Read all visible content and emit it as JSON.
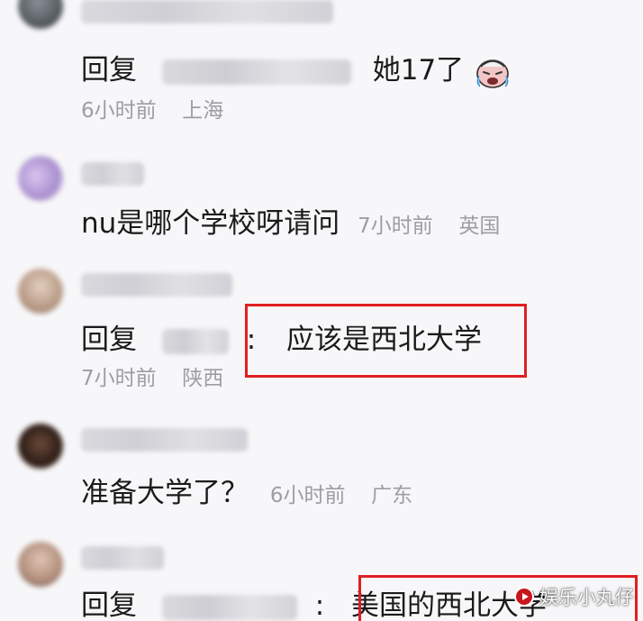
{
  "comments": [
    {
      "reply_prefix": "回复",
      "text": "她17了",
      "time": "6小时前",
      "location": "上海"
    },
    {
      "text": "nu是哪个学校呀请问",
      "time": "7小时前",
      "location": "英国"
    },
    {
      "reply_prefix": "回复",
      "separator": ":",
      "text": "应该是西北大学",
      "time": "7小时前",
      "location": "陕西"
    },
    {
      "text": "准备大学了？",
      "time": "6小时前",
      "location": "广东"
    },
    {
      "reply_prefix": "回复",
      "separator": ":",
      "text": "美国的西北大学"
    }
  ],
  "watermark": {
    "text": "娱乐小丸仔"
  },
  "colors": {
    "highlight": "#e02020",
    "meta_text": "#9d9da3",
    "body_text": "#1b1b1b"
  },
  "icons": {
    "crying_emoji": "crying-face-icon",
    "watermark_logo": "play-logo-icon"
  }
}
